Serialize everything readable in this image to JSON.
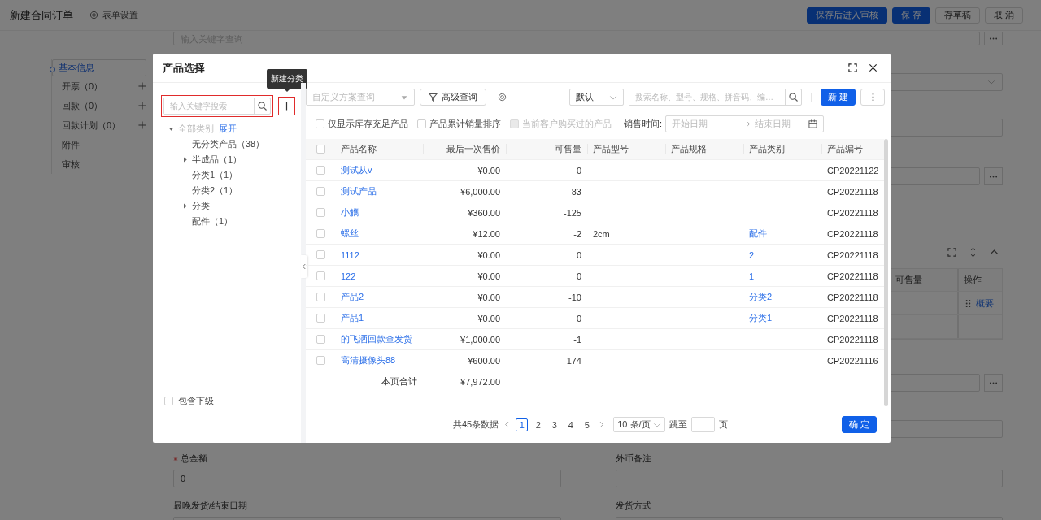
{
  "page": {
    "header": {
      "title": "新建合同订单",
      "settings": "表单设置",
      "buttons": [
        {
          "label": "保存后进入审核",
          "kind": "primary"
        },
        {
          "label": "保 存",
          "kind": "primary"
        },
        {
          "label": "存草稿",
          "kind": "default"
        },
        {
          "label": "取 消",
          "kind": "default"
        }
      ]
    },
    "nav": [
      {
        "label": "基本信息",
        "selected": true,
        "addable": false
      },
      {
        "label": "开票（0）",
        "selected": false,
        "addable": true
      },
      {
        "label": "回款（0）",
        "selected": false,
        "addable": true
      },
      {
        "label": "回款计划（0）",
        "selected": false,
        "addable": true
      },
      {
        "label": "附件",
        "selected": false,
        "addable": false
      },
      {
        "label": "审核",
        "selected": false,
        "addable": false
      }
    ],
    "form": {
      "top_search": {
        "placeholder": "输入关键字查询"
      },
      "table": {
        "columns": [
          "可售量",
          "操作"
        ],
        "rows": [
          {
            "action": "概要"
          }
        ]
      },
      "bottom_fields": [
        {
          "label": "总金额",
          "required": true,
          "value": "0"
        },
        {
          "label": "外币备注",
          "required": false
        },
        {
          "label": "最晚发货/结束日期",
          "required": false
        },
        {
          "label": "发货方式",
          "required": false
        }
      ]
    }
  },
  "dialog": {
    "title": "产品选择",
    "tooltip": "新建分类",
    "category_search": {
      "placeholder": "输入关键字搜索"
    },
    "tree": {
      "label": "全部类别",
      "link": "展开",
      "disabled": true,
      "expanded": true,
      "children": [
        {
          "label": "无分类产品（38）",
          "expandable": false
        },
        {
          "label": "半成品（1）",
          "expandable": true
        },
        {
          "label": "分类1（1）",
          "expandable": false
        },
        {
          "label": "分类2（1）",
          "expandable": false
        },
        {
          "label": "分类",
          "expandable": true
        },
        {
          "label": "配件（1）",
          "expandable": false
        }
      ]
    },
    "include_sub": {
      "label": "包含下级",
      "checked": false
    },
    "toolbar": {
      "scheme": {
        "placeholder": "自定义方案查询"
      },
      "advanced": "高级查询",
      "sort": "默认",
      "search": {
        "placeholder": "搜索名称、型号、规格、拼音码、编…"
      },
      "new": "新 建"
    },
    "filters": [
      {
        "label": "仅显示库存充足产品",
        "checked": false,
        "disabled": false
      },
      {
        "label": "产品累计销量排序",
        "checked": false,
        "disabled": false
      },
      {
        "label": "当前客户购买过的产品",
        "checked": false,
        "disabled": true
      }
    ],
    "sale_time": {
      "label": "销售时间:",
      "start": "开始日期",
      "end": "结束日期"
    },
    "table": {
      "all_checked": false,
      "columns": [
        "产品名称",
        "最后一次售价",
        "可售量",
        "产品型号",
        "产品规格",
        "产品类别",
        "产品编号"
      ],
      "rows": [
        {
          "checked": false,
          "name": "测试从v",
          "price": "¥0.00",
          "stock": "0",
          "code": "CP20221122"
        },
        {
          "checked": false,
          "name": "测试产品",
          "price": "¥6,000.00",
          "stock": "83",
          "code": "CP20221118"
        },
        {
          "checked": false,
          "name": "小觽",
          "price": "¥360.00",
          "stock": "-125",
          "code": "CP20221118"
        },
        {
          "checked": false,
          "name": "螺丝",
          "price": "¥12.00",
          "stock": "-2",
          "model": "2cm",
          "category": "配件",
          "code": "CP20221118"
        },
        {
          "checked": false,
          "name": "1112",
          "price": "¥0.00",
          "stock": "0",
          "category": "2",
          "code": "CP20221118"
        },
        {
          "checked": false,
          "name": "122",
          "price": "¥0.00",
          "stock": "0",
          "category": "1",
          "code": "CP20221118"
        },
        {
          "checked": false,
          "name": "产品2",
          "price": "¥0.00",
          "stock": "-10",
          "category": "分类2",
          "code": "CP20221118"
        },
        {
          "checked": false,
          "name": "产品1",
          "price": "¥0.00",
          "stock": "0",
          "category": "分类1",
          "code": "CP20221118"
        },
        {
          "checked": false,
          "name": "的飞洒回款查发货",
          "price": "¥1,000.00",
          "stock": "-1",
          "code": "CP20221118"
        },
        {
          "checked": false,
          "name": "高清摄像头88",
          "price": "¥600.00",
          "stock": "-174",
          "code": "CP20221116"
        }
      ],
      "summary": {
        "label": "本页合计",
        "price": "¥7,972.00"
      }
    },
    "pagination": {
      "total": "共45条数据",
      "pages": [
        {
          "label": "1",
          "selected": true
        },
        {
          "label": "2",
          "selected": false
        },
        {
          "label": "3",
          "selected": false
        },
        {
          "label": "4",
          "selected": false
        },
        {
          "label": "5",
          "selected": false
        }
      ],
      "page_size": "10 条/页",
      "jump": "跳至",
      "unit": "页"
    },
    "confirm": "确 定"
  }
}
